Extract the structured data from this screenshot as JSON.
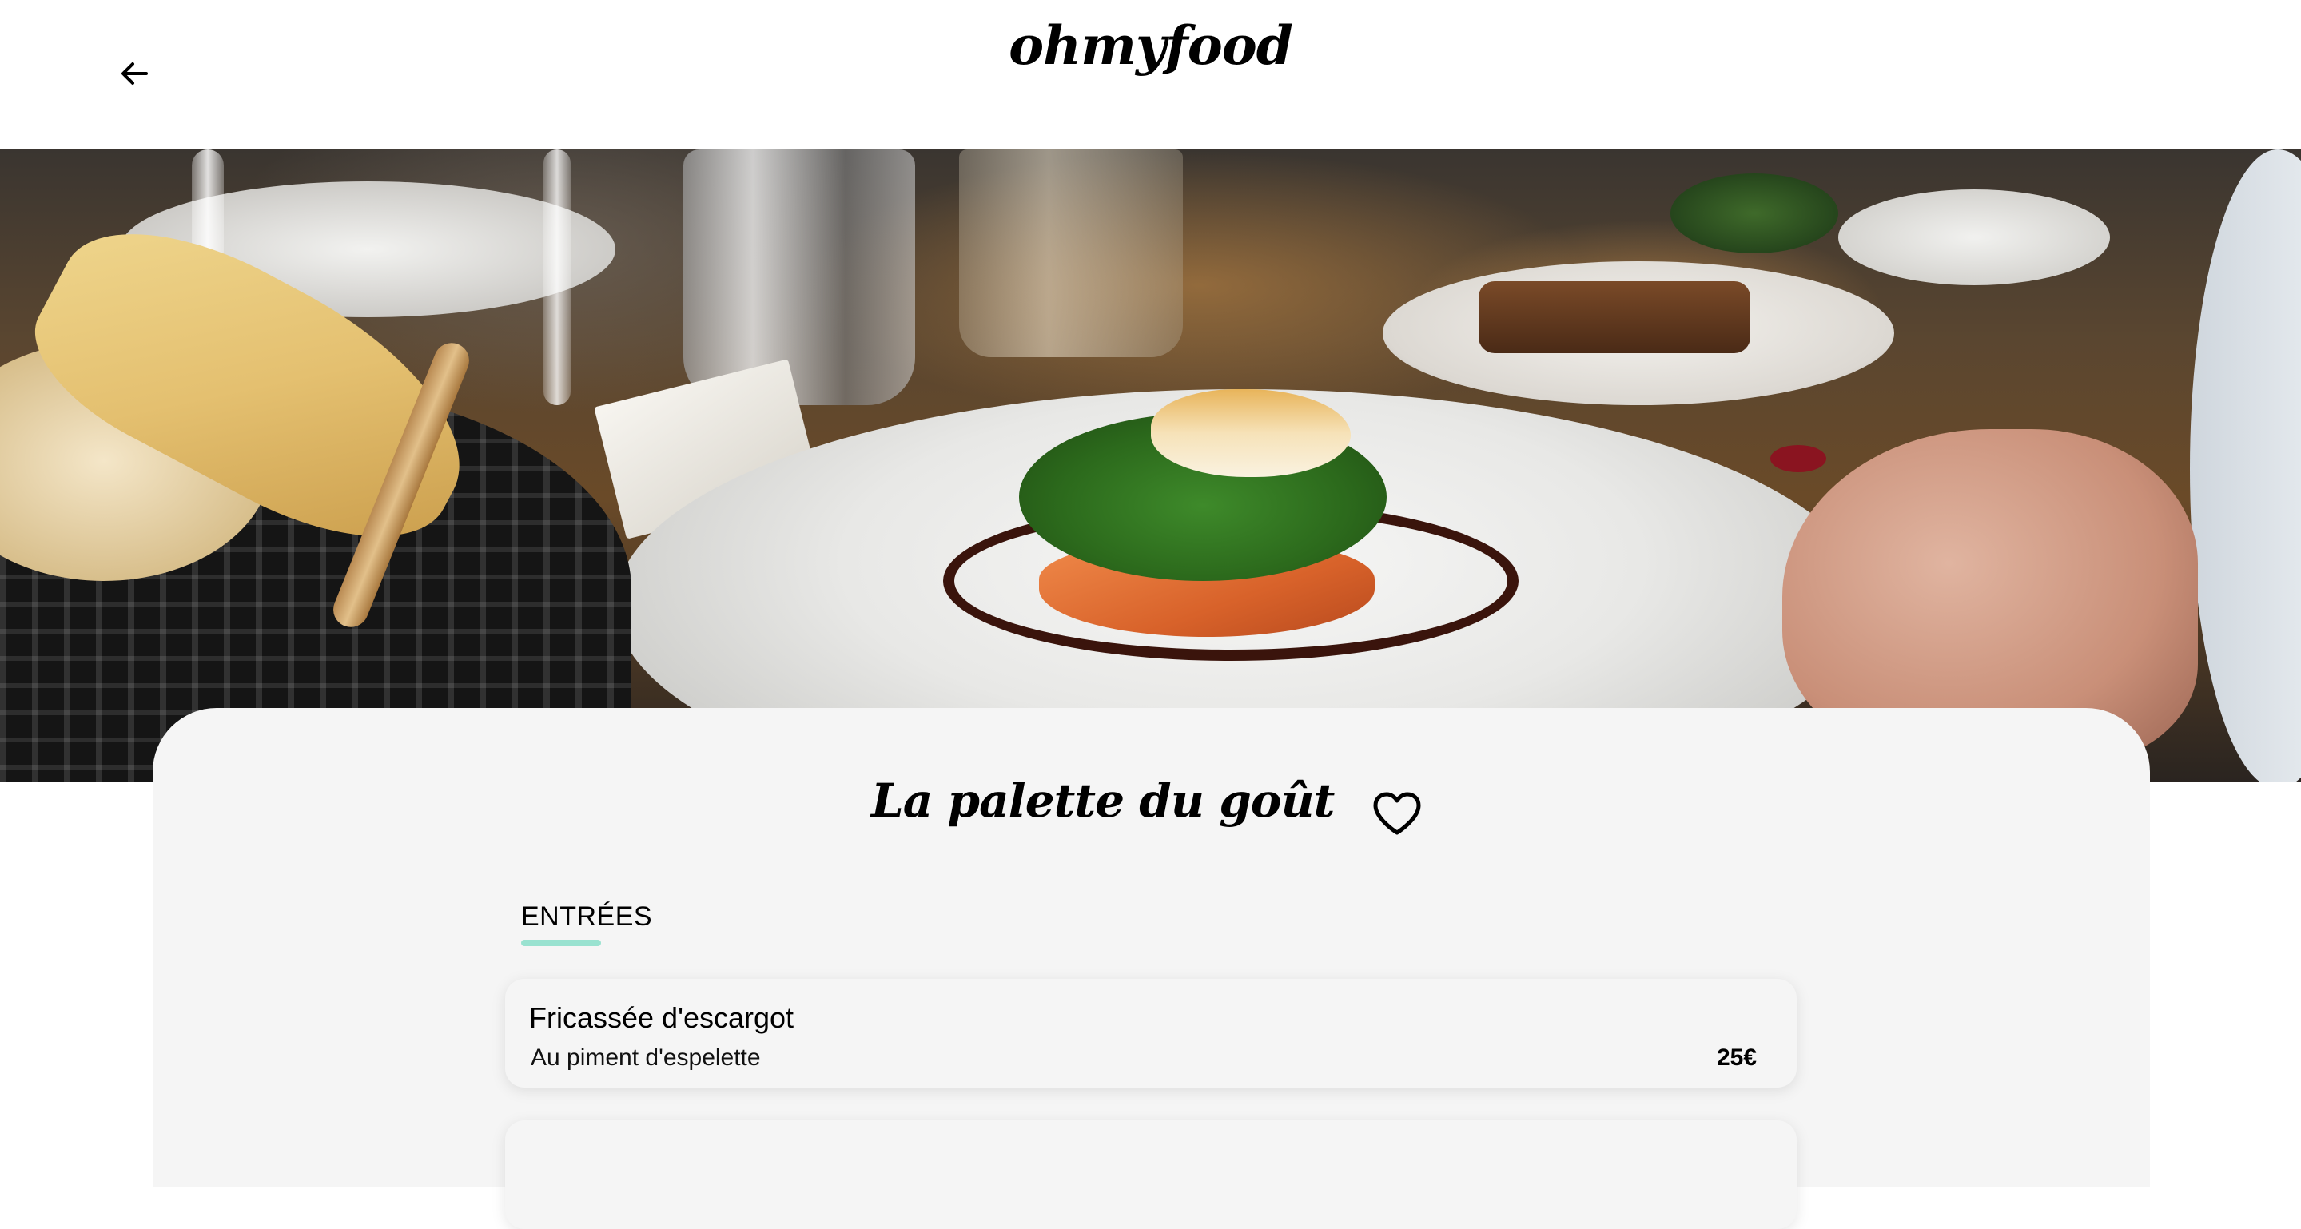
{
  "header": {
    "back_icon": "arrow-left-icon",
    "logo": "ohmyfood"
  },
  "hero": {
    "image": "restaurant-plate-photo"
  },
  "restaurant": {
    "name": "La palette du goût",
    "favorite_icon": "heart-outline-icon"
  },
  "menu": {
    "sections": [
      {
        "title": "ENTRÉES",
        "accent_color": "#99e2d0",
        "items": [
          {
            "name": "Fricassée d'escargot",
            "description": "Au piment d'espelette",
            "price": "25€"
          },
          {
            "name": "",
            "description": "",
            "price": ""
          }
        ]
      }
    ]
  },
  "colors": {
    "card_background": "#f5f5f5",
    "accent": "#99e2d0"
  }
}
